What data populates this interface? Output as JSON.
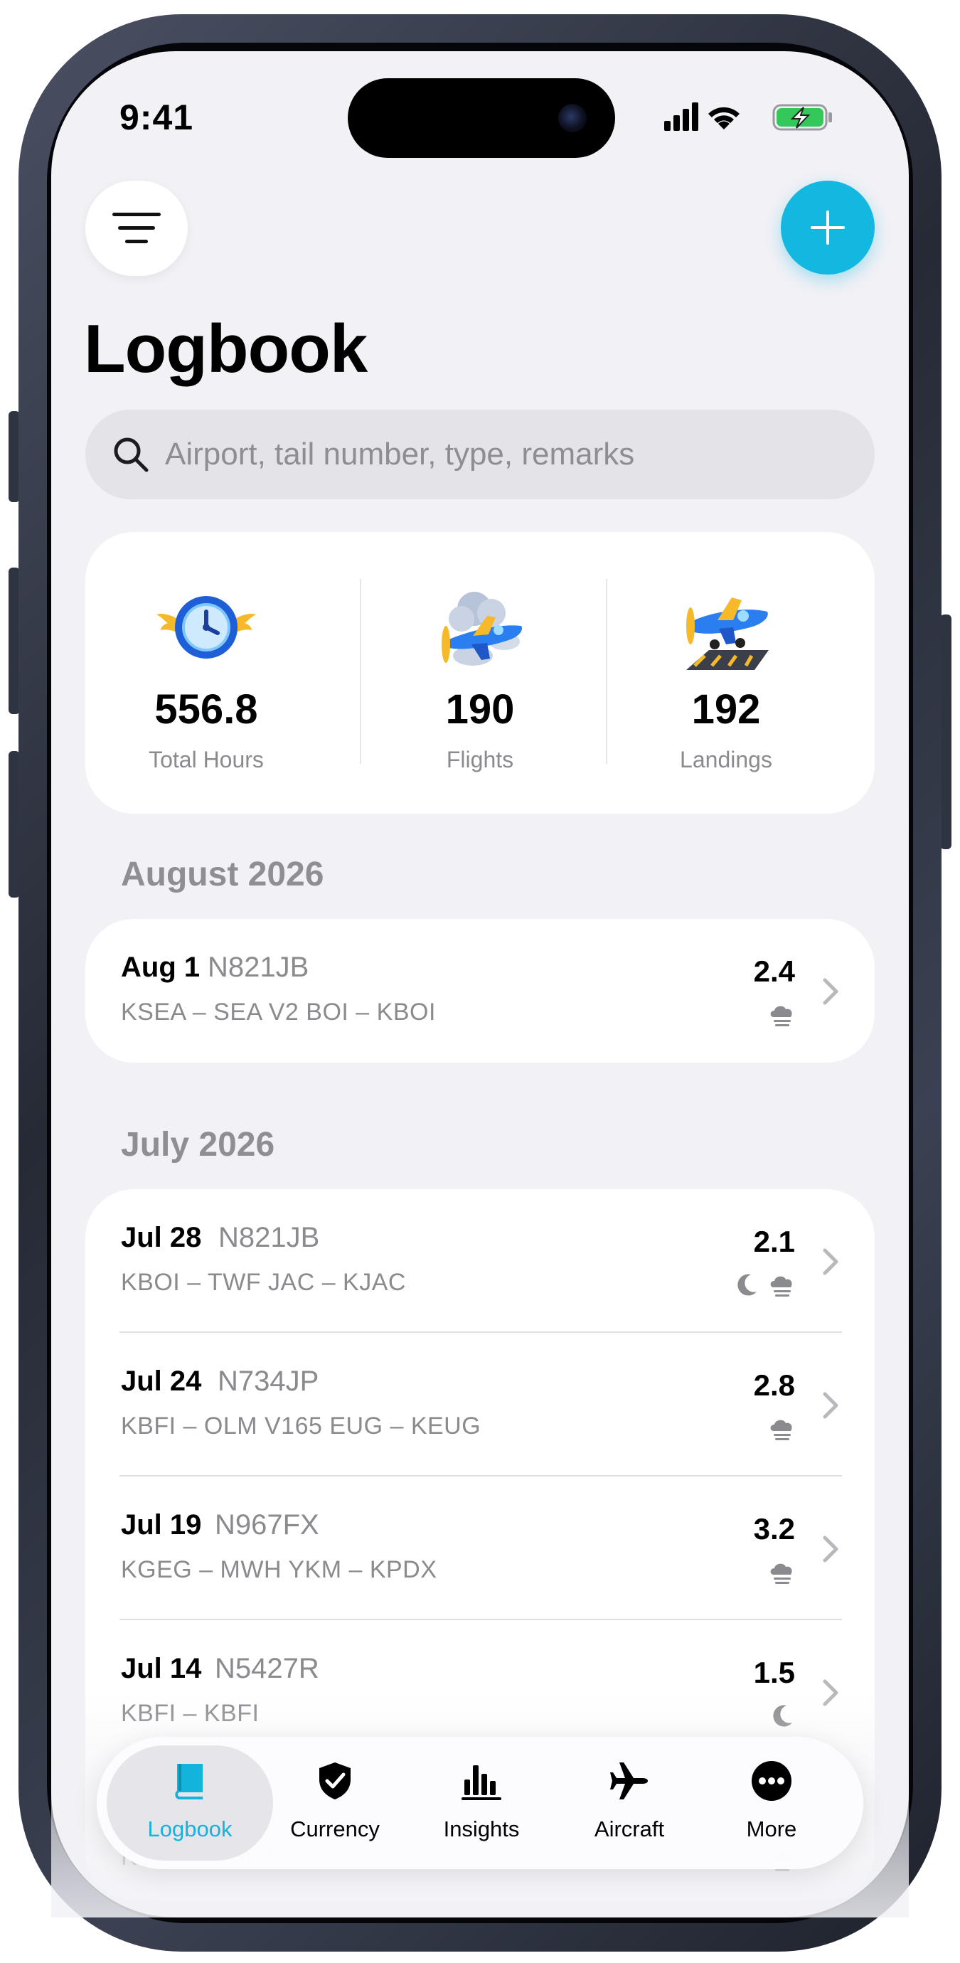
{
  "status_bar": {
    "time": "9:41"
  },
  "header": {
    "title": "Logbook"
  },
  "search": {
    "placeholder": "Airport, tail number, type, remarks",
    "value": ""
  },
  "stats": [
    {
      "value": "556.8",
      "label": "Total Hours",
      "icon": "winged-clock-icon"
    },
    {
      "value": "190",
      "label": "Flights",
      "icon": "airplane-cloud-icon"
    },
    {
      "value": "192",
      "label": "Landings",
      "icon": "airplane-landing-icon"
    }
  ],
  "sections": [
    {
      "title": "August 2026",
      "flights": [
        {
          "date": "Aug 1",
          "tail": "N821JB",
          "route": "KSEA – SEA V2 BOI – KBOI",
          "hours": "2.4",
          "badges": [
            "cloud-icon"
          ]
        }
      ]
    },
    {
      "title": "July 2026",
      "flights": [
        {
          "date": "Jul 28",
          "tail": "N821JB",
          "route": "KBOI – TWF JAC – KJAC",
          "hours": "2.1",
          "badges": [
            "moon-icon",
            "cloud-icon"
          ]
        },
        {
          "date": "Jul 24",
          "tail": "N734JP",
          "route": "KBFI – OLM V165 EUG – KEUG",
          "hours": "2.8",
          "badges": [
            "cloud-icon"
          ]
        },
        {
          "date": "Jul 19",
          "tail": "N967FX",
          "route": "KGEG – MWH YKM – KPDX",
          "hours": "3.2",
          "badges": [
            "cloud-icon"
          ]
        },
        {
          "date": "Jul 14",
          "tail": "N5427R",
          "route": "KBFI – KBFI",
          "hours": "1.5",
          "badges": [
            "moon-icon"
          ]
        },
        {
          "date": "",
          "tail": "",
          "route": "KSEA – KSEA",
          "hours": "",
          "badges": [
            "cloud-icon"
          ]
        }
      ]
    }
  ],
  "tabbar": {
    "active": "Logbook",
    "tabs": [
      {
        "label": "Logbook",
        "icon": "book-icon"
      },
      {
        "label": "Currency",
        "icon": "shield-check-icon"
      },
      {
        "label": "Insights",
        "icon": "bar-chart-icon"
      },
      {
        "label": "Aircraft",
        "icon": "airplane-icon"
      },
      {
        "label": "More",
        "icon": "ellipsis-circle-icon"
      }
    ]
  },
  "colors": {
    "accent": "#13B8E0",
    "background": "#F1F1F6",
    "card": "#FFFFFF",
    "secondary_text": "#8A8A8F"
  }
}
